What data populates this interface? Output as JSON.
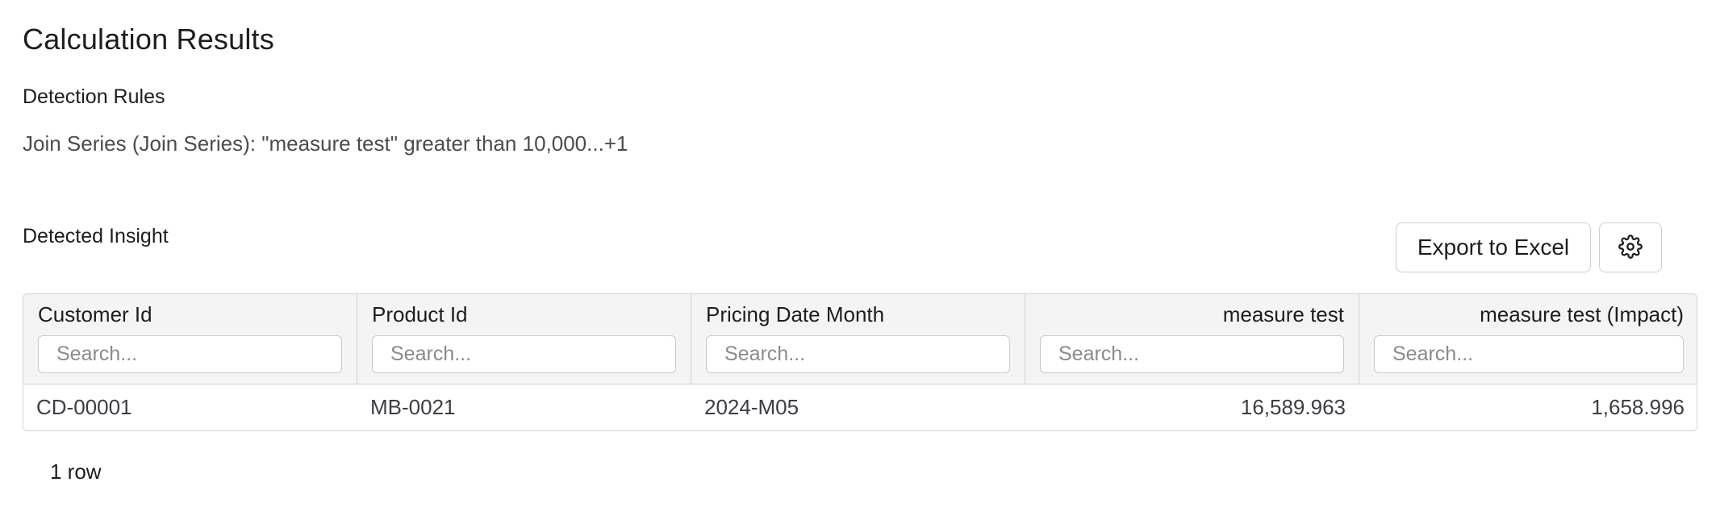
{
  "page": {
    "title": "Calculation Results"
  },
  "detection_rules": {
    "heading": "Detection Rules",
    "text": "Join Series (Join Series): \"measure test\" greater than 10,000...+1"
  },
  "insight": {
    "heading": "Detected Insight",
    "export_label": "Export to Excel",
    "settings_icon": "gear-icon",
    "columns": [
      {
        "label": "Customer Id",
        "placeholder": "Search...",
        "align": "left"
      },
      {
        "label": "Product Id",
        "placeholder": "Search...",
        "align": "left"
      },
      {
        "label": "Pricing Date Month",
        "placeholder": "Search...",
        "align": "left"
      },
      {
        "label": "measure test",
        "placeholder": "Search...",
        "align": "right"
      },
      {
        "label": "measure test (Impact)",
        "placeholder": "Search...",
        "align": "right"
      }
    ],
    "rows": [
      [
        "CD-00001",
        "MB-0021",
        "2024-M05",
        "16,589.963",
        "1,658.996"
      ]
    ],
    "row_count": "1 row"
  }
}
